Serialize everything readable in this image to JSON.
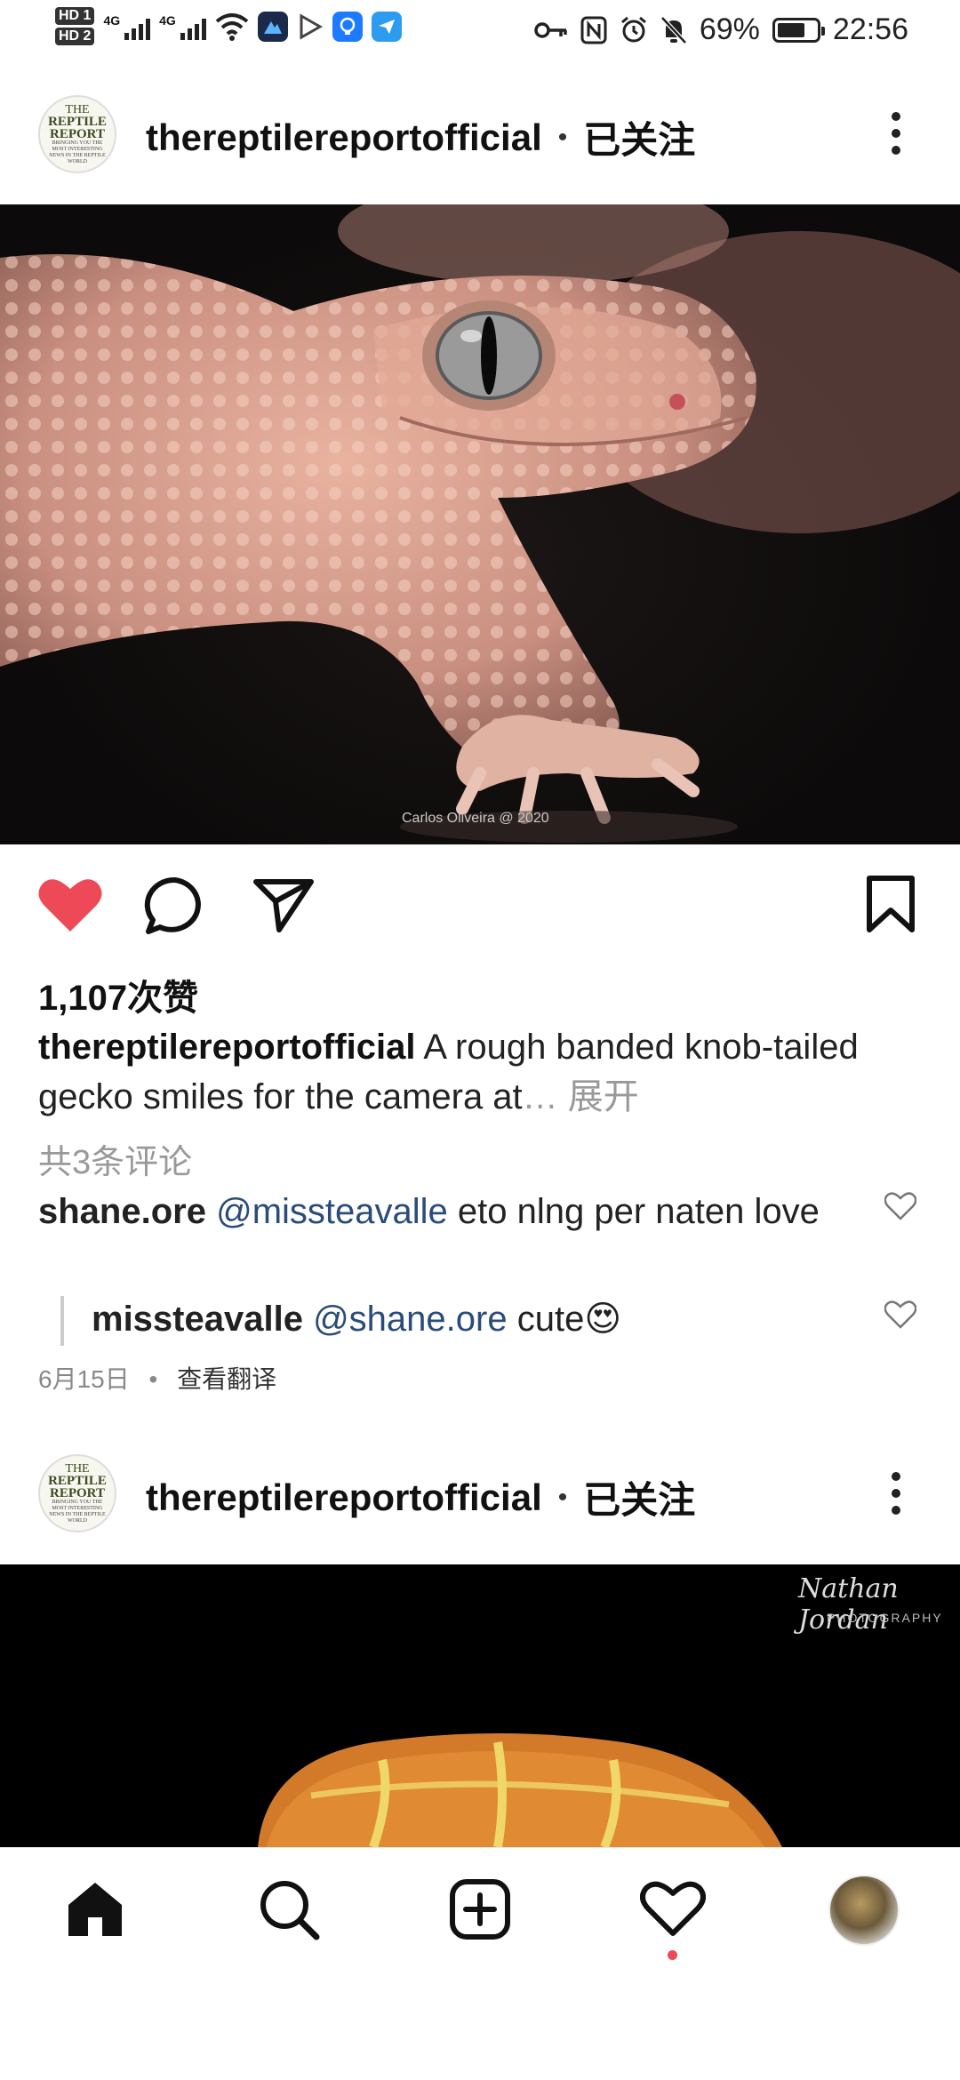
{
  "status_bar": {
    "hd1": "HD 1",
    "hd2": "HD 2",
    "net1": "4G",
    "net2": "4G",
    "battery_pct": "69%",
    "time": "22:56"
  },
  "post1": {
    "username": "thereptilereportofficial",
    "separator": "•",
    "follow_status": "已关注",
    "avatar_text": {
      "line1": "THE",
      "line2": "REPTILE",
      "line3": "REPORT",
      "line4": "BRINGING YOU THE MOST INTERESTING NEWS IN THE REPTILE WORLD"
    },
    "photo_credit": "Carlos Oliveira @ 2020",
    "likes": "1,107次赞",
    "caption_user": "thereptilereportofficial",
    "caption_text": " A rough banded knob-tailed gecko smiles for the camera at",
    "caption_more": "… 展开",
    "view_comments": "共3条评论",
    "comments": [
      {
        "user": "shane.ore",
        "mention": "@missteavalle",
        "text": "  eto nlng per naten love"
      },
      {
        "user": "missteavalle",
        "mention": "@shane.ore",
        "text": " cute😍"
      }
    ],
    "date": "6月15日",
    "date_sep": "•",
    "translate": "查看翻译"
  },
  "post2": {
    "username": "thereptilereportofficial",
    "separator": "•",
    "follow_status": "已关注",
    "watermark_script": "Nathan Jordan",
    "watermark_sub": "PHOTOGRAPHY"
  },
  "colors": {
    "like_red": "#ed4956",
    "mention_blue": "#2a4c7a",
    "notif_dot": "#ed4956"
  }
}
